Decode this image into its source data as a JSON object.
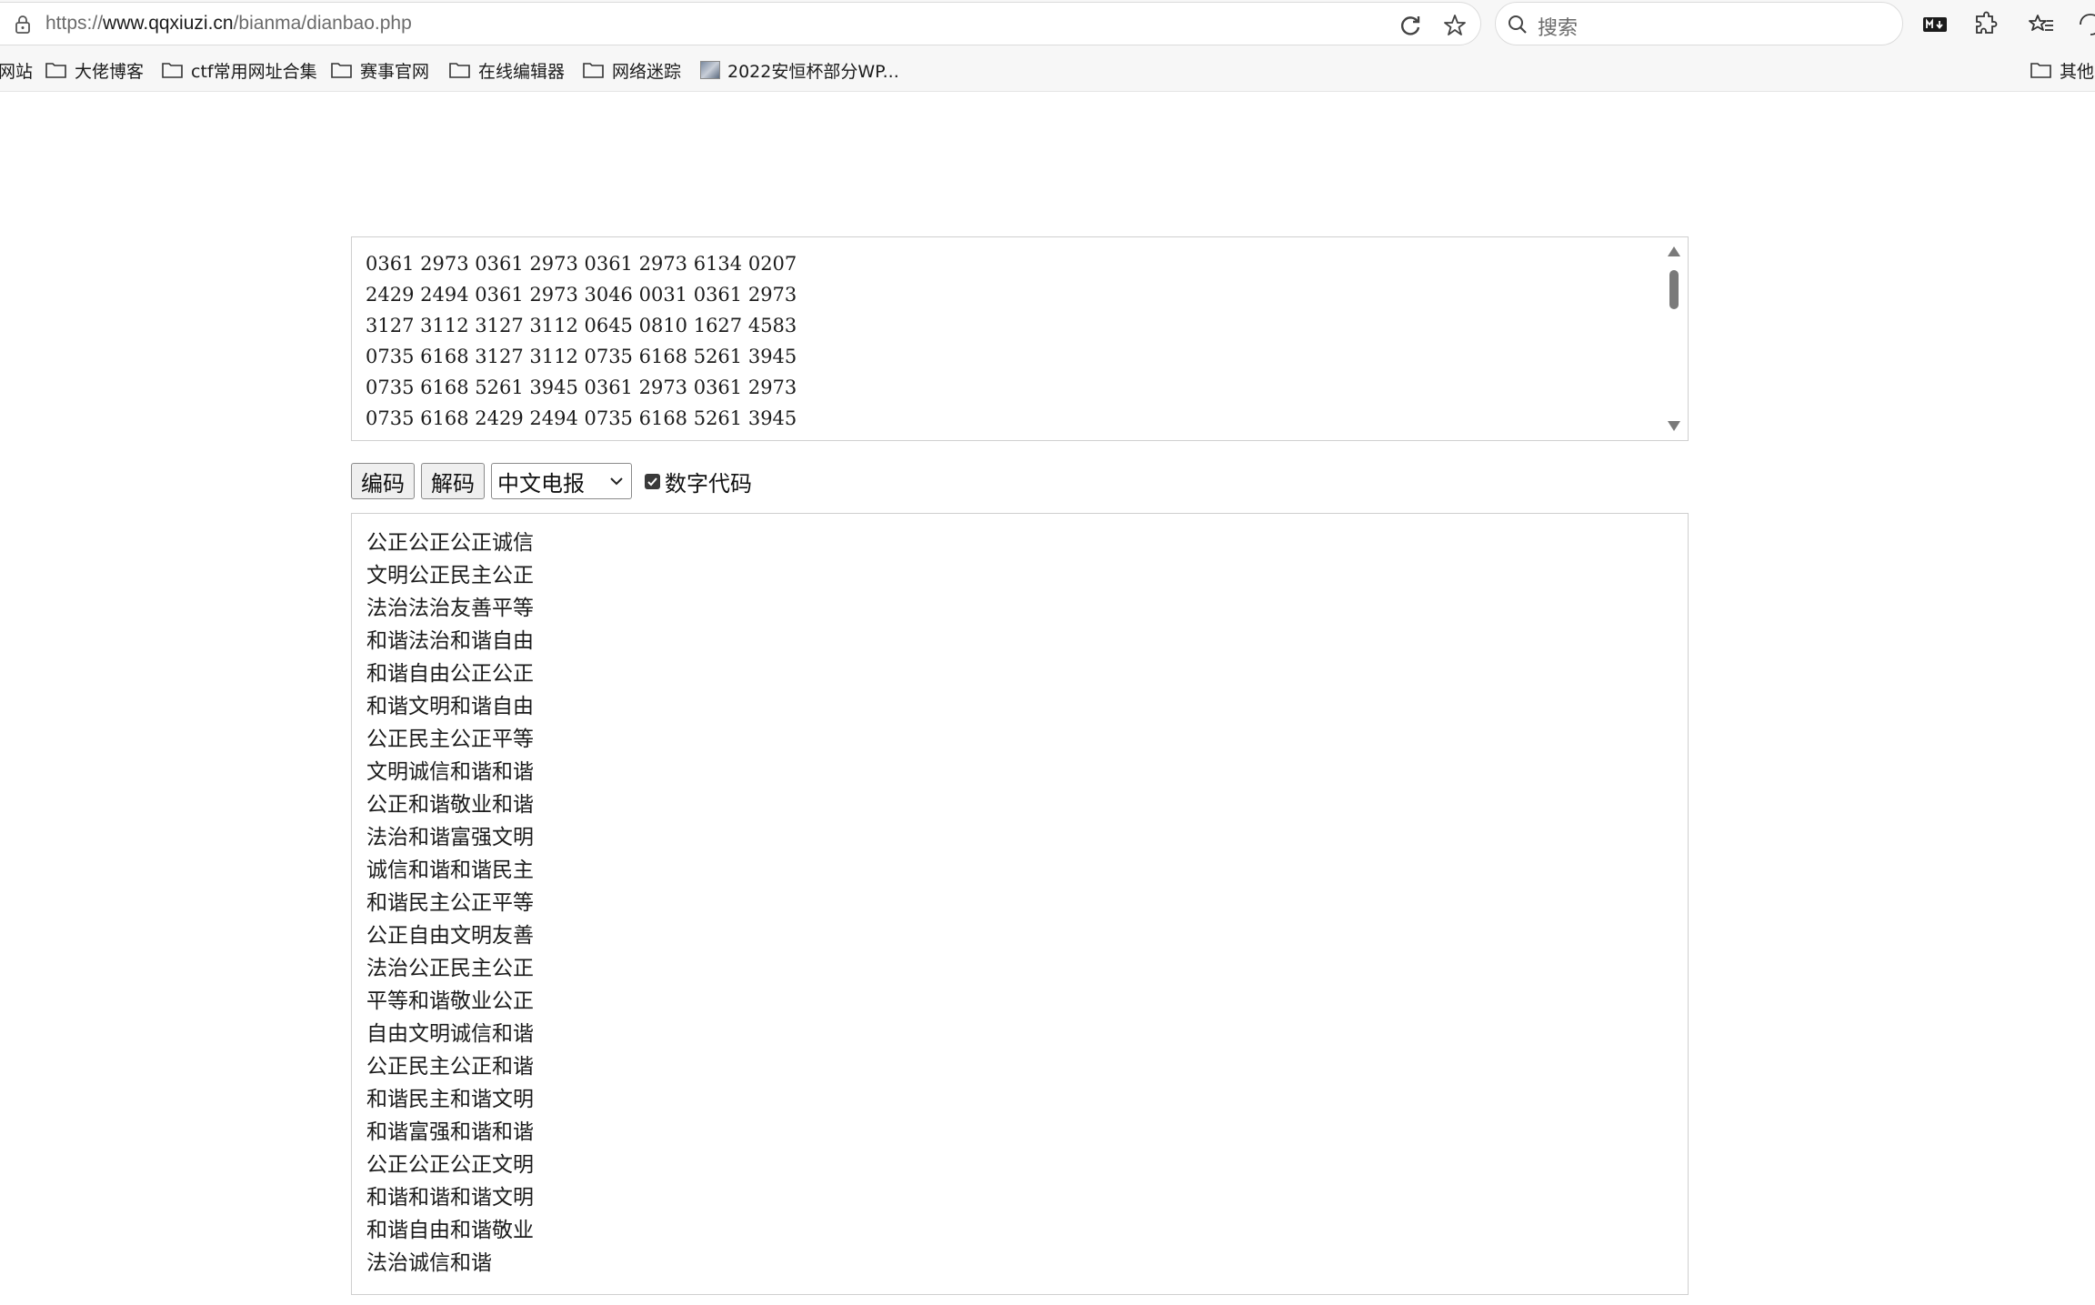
{
  "browser": {
    "url_prefix": "https://",
    "url_host": "www.qqxiuzi.cn",
    "url_path": "/bianma/dianbao.php",
    "search_placeholder": "搜索"
  },
  "bookmarks": {
    "cut_left": "网站",
    "items": [
      {
        "label": "大佬博客",
        "icon": "folder-icon"
      },
      {
        "label": "ctf常用网址合集",
        "icon": "folder-icon"
      },
      {
        "label": "赛事官网",
        "icon": "folder-icon"
      },
      {
        "label": "在线编辑器",
        "icon": "folder-icon"
      },
      {
        "label": "网络迷踪",
        "icon": "folder-icon"
      },
      {
        "label": "2022安恒杯部分WP...",
        "icon": "page-thumbnail-icon"
      }
    ],
    "other": "其他"
  },
  "input_text": "0361 2973 0361 2973 0361 2973 6134 0207\n2429 2494 0361 2973 3046 0031 0361 2973\n3127 3112 3127 3112 0645 0810 1627 4583\n0735 6168 3127 3112 0735 6168 5261 3945\n0735 6168 5261 3945 0361 2973 0361 2973\n0735 6168 2429 2494 0735 6168 5261 3945",
  "controls": {
    "encode_label": "编码",
    "decode_label": "解码",
    "mode_selected": "中文电报",
    "checkbox_label": "数字代码",
    "checkbox_checked": true
  },
  "output_text": "公正公正公正诚信\n文明公正民主公正\n法治法治友善平等\n和谐法治和谐自由\n和谐自由公正公正\n和谐文明和谐自由\n公正民主公正平等\n文明诚信和谐和谐\n公正和谐敬业和谐\n法治和谐富强文明\n诚信和谐和谐民主\n和谐民主公正平等\n公正自由文明友善\n法治公正民主公正\n平等和谐敬业公正\n自由文明诚信和谐\n公正民主公正和谐\n和谐民主和谐文明\n和谐富强和谐和谐\n公正公正公正文明\n和谐和谐和谐文明\n和谐自由和谐敬业\n法治诚信和谐"
}
